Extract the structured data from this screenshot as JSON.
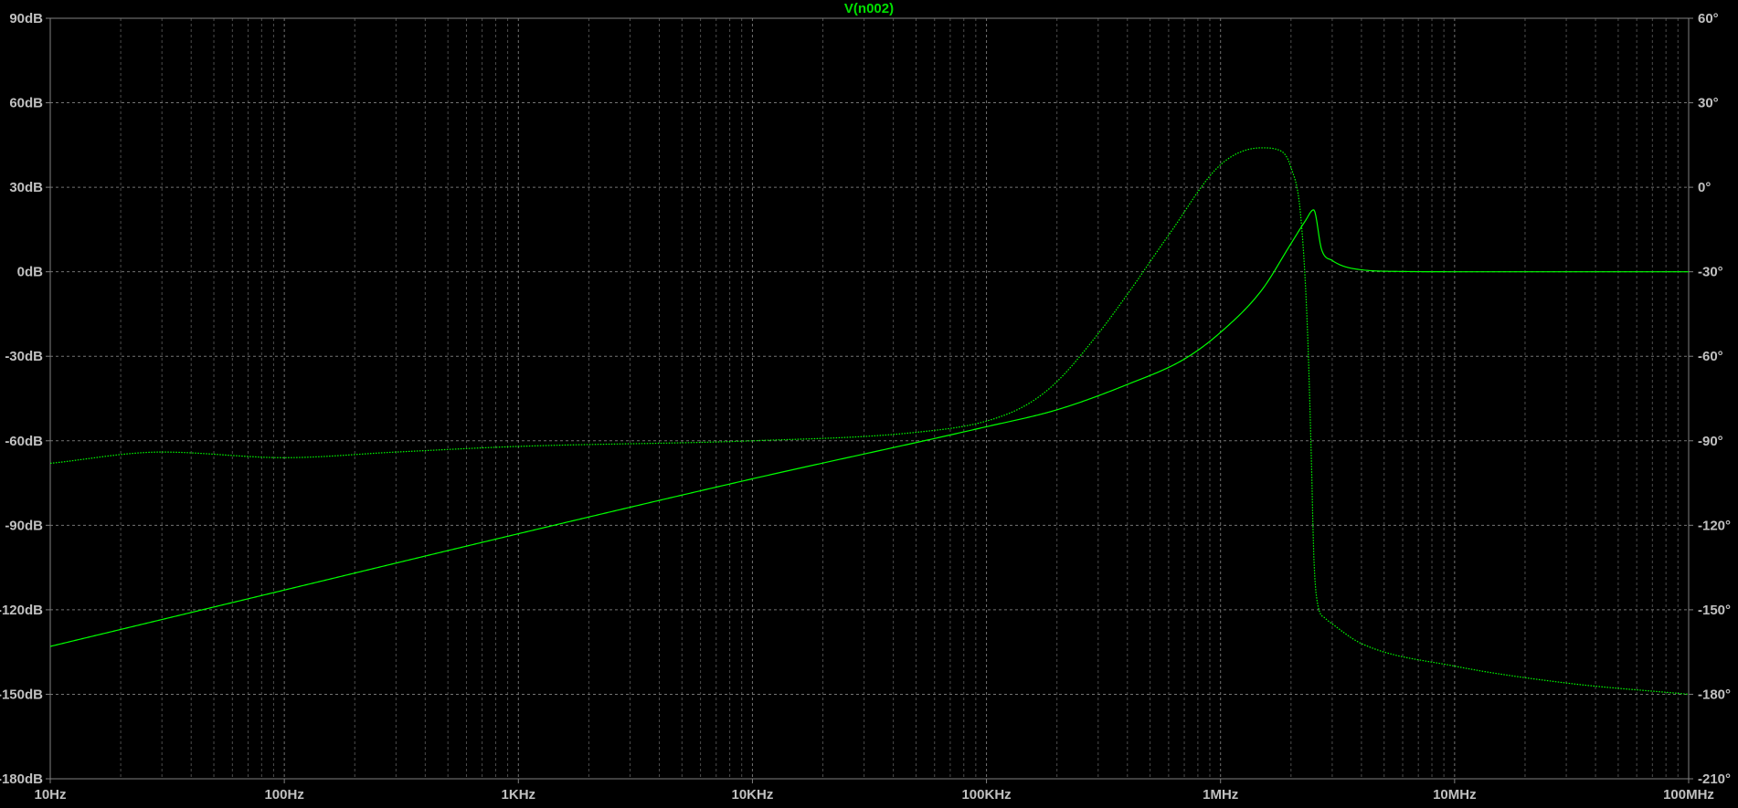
{
  "chart_data": {
    "type": "line",
    "title": "V(n002)",
    "title_color": "#00e000",
    "x_scale": "log",
    "xlim": [
      10,
      100000000
    ],
    "x_ticks": [
      {
        "value": 10,
        "label": "10Hz"
      },
      {
        "value": 100,
        "label": "100Hz"
      },
      {
        "value": 1000,
        "label": "1KHz"
      },
      {
        "value": 10000,
        "label": "10KHz"
      },
      {
        "value": 100000,
        "label": "100KHz"
      },
      {
        "value": 1000000,
        "label": "1MHz"
      },
      {
        "value": 10000000,
        "label": "10MHz"
      },
      {
        "value": 100000000,
        "label": "100MHz"
      }
    ],
    "ylim_left": [
      -180,
      90
    ],
    "y_ticks_left": [
      {
        "value": 90,
        "label": "90dB"
      },
      {
        "value": 60,
        "label": "60dB"
      },
      {
        "value": 30,
        "label": "30dB"
      },
      {
        "value": 0,
        "label": "0dB"
      },
      {
        "value": -30,
        "label": "-30dB"
      },
      {
        "value": -60,
        "label": "-60dB"
      },
      {
        "value": -90,
        "label": "-90dB"
      },
      {
        "value": -120,
        "label": "-120dB"
      },
      {
        "value": -150,
        "label": "-150dB"
      },
      {
        "value": -180,
        "label": "-180dB"
      }
    ],
    "ylim_right": [
      -210,
      60
    ],
    "y_ticks_right": [
      {
        "value": 60,
        "label": "60°"
      },
      {
        "value": 30,
        "label": "30°"
      },
      {
        "value": 0,
        "label": "0°"
      },
      {
        "value": -30,
        "label": "-30°"
      },
      {
        "value": -60,
        "label": "-60°"
      },
      {
        "value": -90,
        "label": "-90°"
      },
      {
        "value": -120,
        "label": "-120°"
      },
      {
        "value": -150,
        "label": "-150°"
      },
      {
        "value": -180,
        "label": "-180°"
      },
      {
        "value": -210,
        "label": "-210°"
      }
    ],
    "grid": true,
    "background": "#000000",
    "grid_color": "#808080",
    "axis_color": "#808080",
    "label_color": "#c0c0c0",
    "series": [
      {
        "axis": "left",
        "style": "solid",
        "color": "#00ff00",
        "x": [
          10,
          100,
          1000,
          10000,
          100000,
          200000,
          400000,
          700000,
          1000000,
          1500000,
          2000000,
          2300000,
          2500000,
          2700000,
          3000000,
          4000000,
          6000000,
          10000000,
          30000000,
          100000000
        ],
        "y": [
          -133,
          -113,
          -93,
          -73.5,
          -55,
          -49,
          -40,
          -31,
          -21.5,
          -6.5,
          10,
          18,
          22,
          8,
          4,
          0.7,
          0.1,
          0,
          0,
          0
        ]
      },
      {
        "axis": "right",
        "style": "dotted",
        "color": "#00ff00",
        "x": [
          10,
          30,
          100,
          300,
          1000,
          10000,
          50000,
          100000,
          150000,
          200000,
          300000,
          400000,
          600000,
          1000000,
          1500000,
          1800000,
          2000000,
          2200000,
          2350000,
          2450000,
          2500000,
          2600000,
          2800000,
          3000000,
          4000000,
          10000000,
          30000000,
          100000000
        ],
        "y": [
          -98,
          -94,
          -96,
          -94,
          -92,
          -90,
          -87,
          -83,
          -77,
          -69,
          -52,
          -38,
          -17,
          8,
          14,
          13,
          7,
          -10,
          -50,
          -100,
          -130,
          -148,
          -153,
          -155,
          -162,
          -170,
          -176,
          -180
        ]
      }
    ]
  }
}
